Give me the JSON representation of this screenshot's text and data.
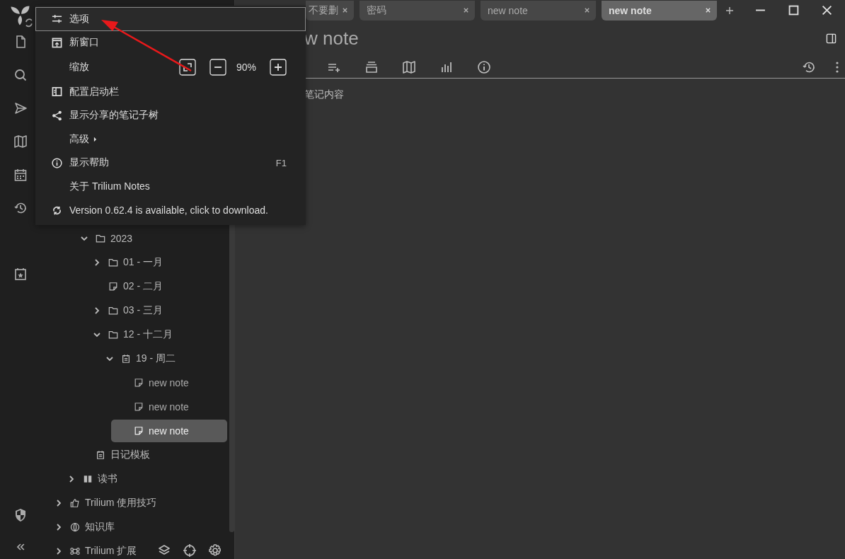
{
  "tabs": [
    {
      "label": "不要删",
      "selected": false
    },
    {
      "label": "密码",
      "selected": false
    },
    {
      "label": "new note",
      "selected": false
    },
    {
      "label": "new note",
      "selected": true
    }
  ],
  "note": {
    "title": "w note",
    "content": "笔记内容"
  },
  "tree": [
    {
      "children": [
        {
          "children": [
            {
              "label": "2023",
              "kind": "folder",
              "expanded": true,
              "selected": false,
              "children": [
                {
                  "label": "01 - 一月",
                  "kind": "folder",
                  "expanded": false,
                  "selected": false
                },
                {
                  "label": "02 - 二月",
                  "kind": "note",
                  "selected": false
                },
                {
                  "label": "03 - 三月",
                  "kind": "folder",
                  "expanded": false,
                  "selected": false
                },
                {
                  "label": "12 - 十二月",
                  "kind": "folder",
                  "expanded": true,
                  "selected": false,
                  "children": [
                    {
                      "label": "19 - 周二",
                      "kind": "day",
                      "expanded": true,
                      "selected": false,
                      "children": [
                        {
                          "label": "new note",
                          "kind": "note",
                          "selected": false
                        },
                        {
                          "label": "new note",
                          "kind": "note",
                          "selected": false
                        },
                        {
                          "label": "new note",
                          "kind": "note",
                          "selected": true
                        }
                      ]
                    }
                  ]
                }
              ]
            },
            {
              "label": "日记模板",
              "kind": "day",
              "selected": false
            }
          ]
        },
        {
          "label": "读书",
          "kind": "book",
          "expanded": false,
          "selected": false
        }
      ]
    },
    {
      "label": "Trilium 使用技巧",
      "kind": "tips",
      "expanded": false,
      "selected": false
    },
    {
      "label": "知识库",
      "kind": "knowledge",
      "expanded": false,
      "selected": false
    },
    {
      "label": "Trilium 扩展",
      "kind": "shortcut",
      "expanded": false,
      "selected": false
    }
  ],
  "menu": [
    {
      "kind": "item",
      "label": "选项",
      "selected": true
    },
    {
      "kind": "item",
      "label": "新窗口",
      "selected": false
    },
    {
      "kind": "zoom",
      "label": "缩放",
      "value": "90%",
      "selected": false
    },
    {
      "kind": "item",
      "label": "配置启动栏",
      "selected": false
    },
    {
      "kind": "item",
      "label": "显示分享的笔记子树",
      "selected": false
    },
    {
      "kind": "submenu",
      "label": "高级",
      "selected": false
    },
    {
      "kind": "item",
      "label": "显示帮助",
      "shortcut": "F1",
      "selected": false
    },
    {
      "kind": "item",
      "label": "关于 Trilium Notes",
      "selected": false
    },
    {
      "kind": "item",
      "label": "Version 0.62.4 is available, click to download.",
      "selected": false
    }
  ]
}
